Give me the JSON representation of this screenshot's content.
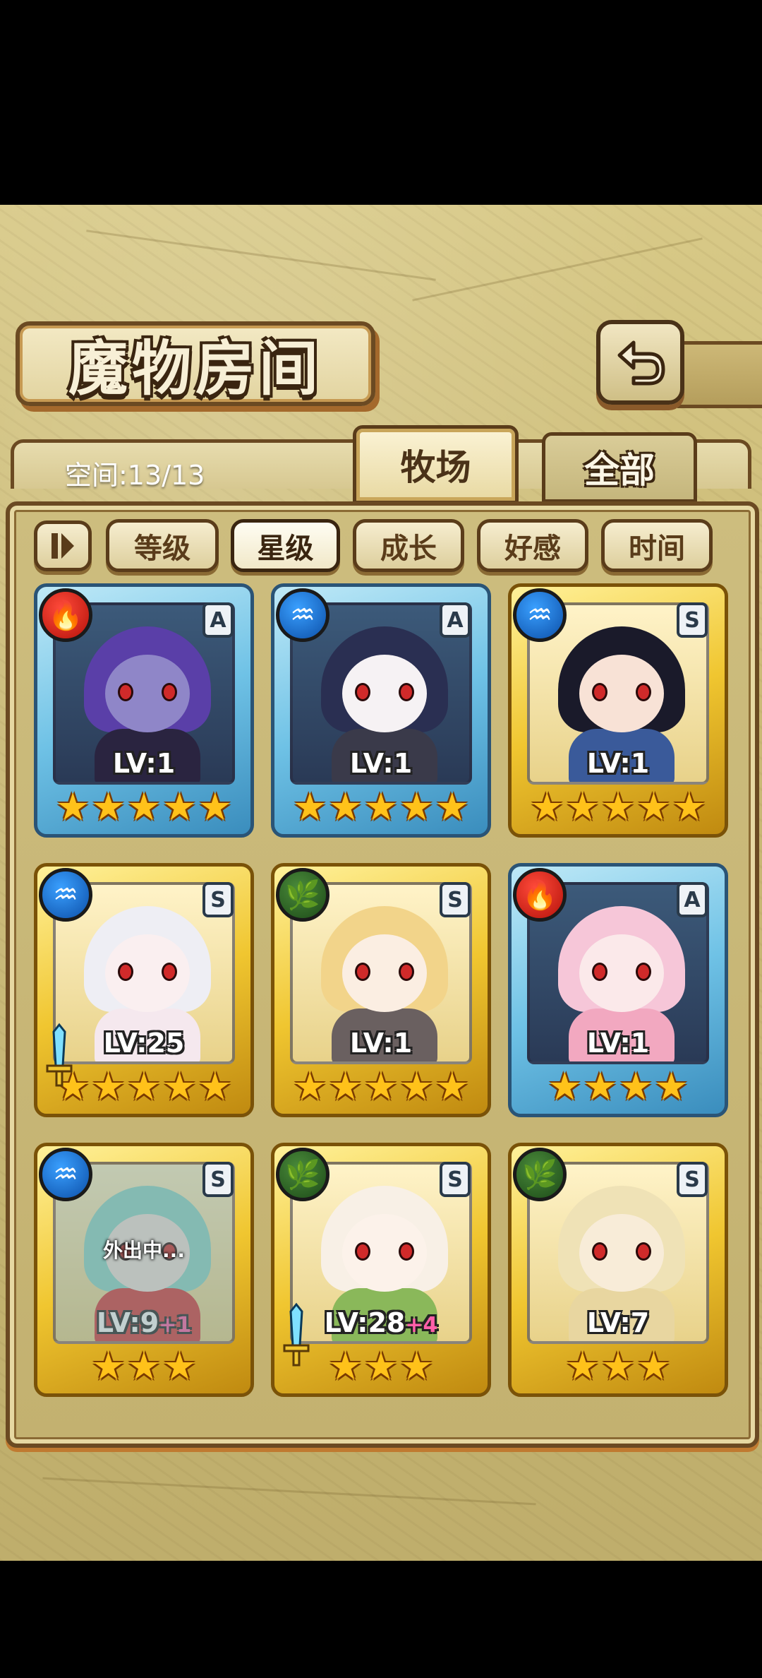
{
  "header": {
    "title": "魔物房间",
    "back_icon": "return-arrow-icon"
  },
  "tabs": {
    "space_label": "空间:13/13",
    "active": "牧场",
    "inactive": "全部"
  },
  "sort": {
    "toggle_icon": "sort-direction-icon",
    "buttons": [
      "等级",
      "星级",
      "成长",
      "好感",
      "时间"
    ],
    "selected": "星级"
  },
  "cards": [
    {
      "element": "fire",
      "rank": "A",
      "frame": "blue",
      "level": "LV:1",
      "bonus": "",
      "stars": 5,
      "status": "",
      "equipped": false,
      "hair": "#5a3fa8",
      "skin": "#8f86c8",
      "body": "#2a2440"
    },
    {
      "element": "water",
      "rank": "A",
      "frame": "blue",
      "level": "LV:1",
      "bonus": "",
      "stars": 5,
      "status": "",
      "equipped": false,
      "hair": "#2a2f52",
      "skin": "#f6f2f4",
      "body": "#3a3a4a"
    },
    {
      "element": "water",
      "rank": "S",
      "frame": "gold",
      "level": "LV:1",
      "bonus": "",
      "stars": 5,
      "status": "",
      "equipped": false,
      "hair": "#1a1a2a",
      "skin": "#f8e2d6",
      "body": "#3a5a9a"
    },
    {
      "element": "water",
      "rank": "S",
      "frame": "gold",
      "level": "LV:25",
      "bonus": "",
      "stars": 5,
      "status": "",
      "equipped": true,
      "hair": "#eeeef4",
      "skin": "#faeff0",
      "body": "#f5e8ee"
    },
    {
      "element": "wood",
      "rank": "S",
      "frame": "gold",
      "level": "LV:1",
      "bonus": "",
      "stars": 5,
      "status": "",
      "equipped": false,
      "hair": "#f2d48a",
      "skin": "#fbeee2",
      "body": "#6a6060"
    },
    {
      "element": "fire",
      "rank": "A",
      "frame": "blue",
      "level": "LV:1",
      "bonus": "",
      "stars": 4,
      "status": "",
      "equipped": false,
      "hair": "#f6c6d8",
      "skin": "#fbe9ea",
      "body": "#f2a8c0"
    },
    {
      "element": "water",
      "rank": "S",
      "frame": "gold",
      "level": "LV:9",
      "bonus": "+1",
      "stars": 3,
      "status": "外出中...",
      "equipped": false,
      "hair": "#8fd8c8",
      "skin": "#f2e4dc",
      "body": "#d83a3a"
    },
    {
      "element": "wood",
      "rank": "S",
      "frame": "gold",
      "level": "LV:28",
      "bonus": "+4",
      "stars": 3,
      "status": "",
      "equipped": true,
      "hair": "#f8f0e6",
      "skin": "#fcf2ea",
      "body": "#8ab85a"
    },
    {
      "element": "wood",
      "rank": "S",
      "frame": "gold",
      "level": "LV:7",
      "bonus": "",
      "stars": 3,
      "status": "",
      "equipped": false,
      "hair": "#efe2b6",
      "skin": "#f8ecd8",
      "body": "#e8d6a0"
    }
  ],
  "colors": {
    "fire": "#d0201a",
    "water": "#1a6fd0",
    "wood": "#2a5a22",
    "star": "#ffc21a",
    "bonus": "#ff5fa8"
  }
}
